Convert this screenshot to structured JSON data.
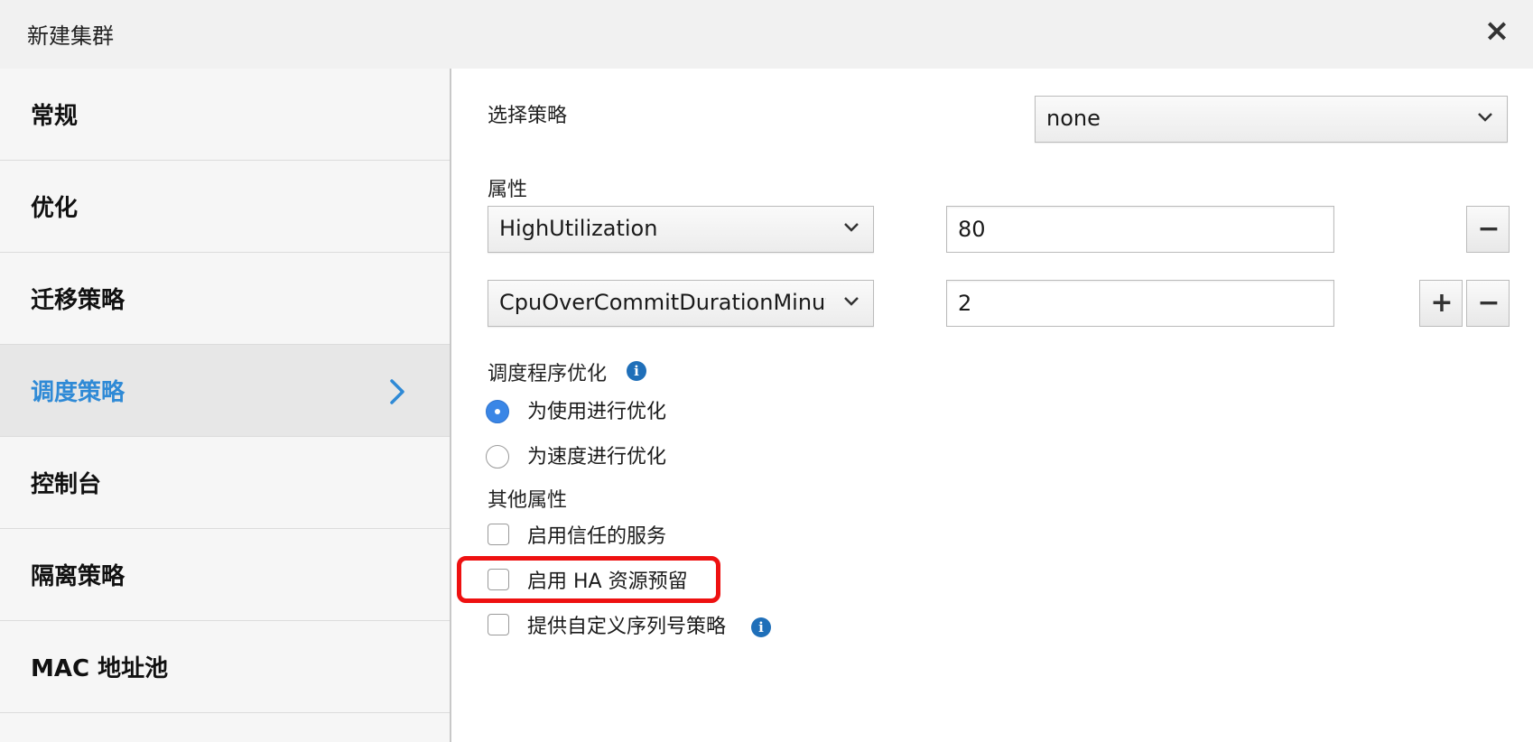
{
  "dialog": {
    "title": "新建集群",
    "close_label": "×"
  },
  "sidebar": {
    "items": [
      {
        "label": "常规"
      },
      {
        "label": "优化"
      },
      {
        "label": "迁移策略"
      },
      {
        "label": "调度策略"
      },
      {
        "label": "控制台"
      },
      {
        "label": "隔离策略"
      },
      {
        "label": "MAC 地址池"
      }
    ]
  },
  "content": {
    "policy_label": "选择策略",
    "policy_value": "none",
    "properties_label": "属性",
    "properties": [
      {
        "key": "HighUtilization",
        "value": "80"
      },
      {
        "key": "CpuOverCommitDurationMinutes",
        "value": "2"
      }
    ],
    "add_symbol": "+",
    "remove_symbol": "−",
    "optimization_label": "调度程序优化",
    "info_symbol": "i",
    "optimization_options": [
      {
        "label": "为使用进行优化",
        "selected": true
      },
      {
        "label": "为速度进行优化",
        "selected": false
      }
    ],
    "other_label": "其他属性",
    "other_options": [
      {
        "label": "启用信任的服务",
        "checked": false
      },
      {
        "label": "启用 HA 资源预留",
        "checked": false
      },
      {
        "label": "提供自定义序列号策略",
        "checked": false
      }
    ]
  },
  "colors": {
    "accent": "#2f8ad6",
    "highlight": "#ee1111",
    "radio_selected": "#3a86e6",
    "info": "#1f6fb9"
  }
}
